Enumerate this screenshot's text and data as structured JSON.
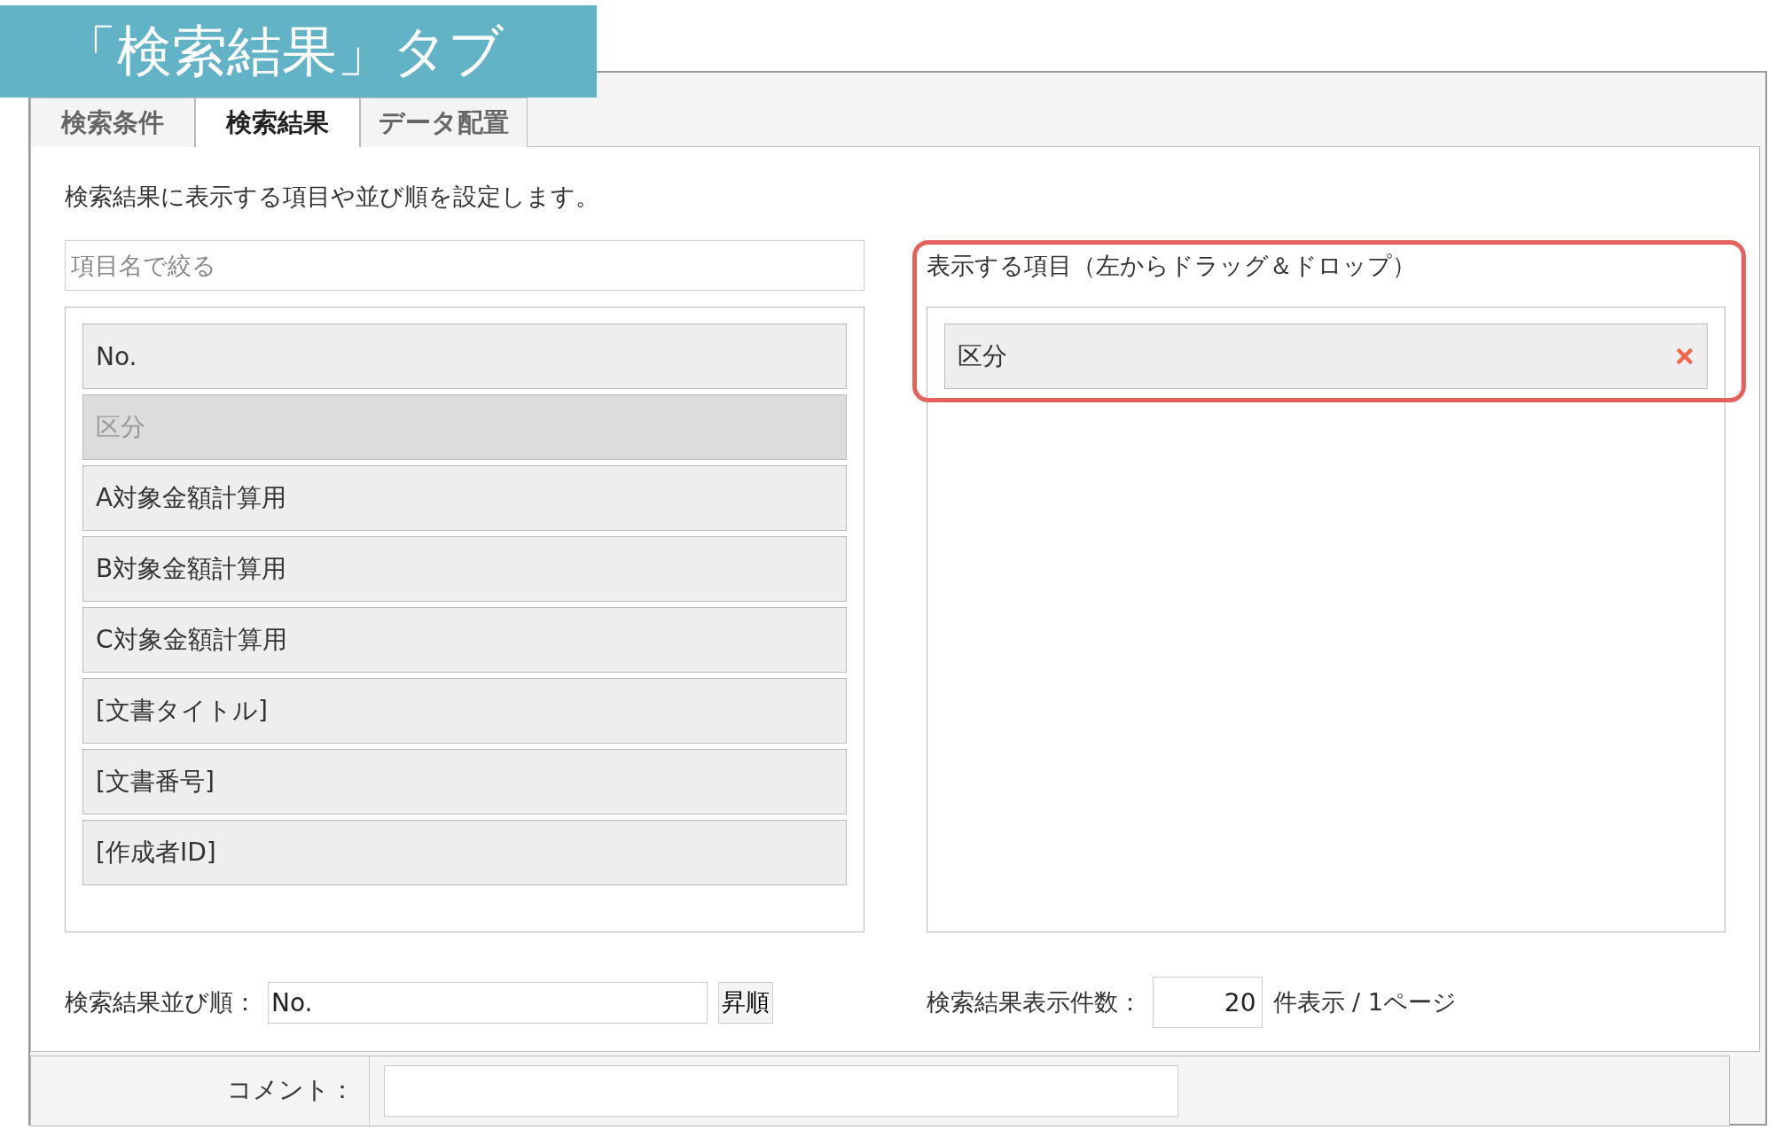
{
  "banner": {
    "title": "「検索結果」タブ"
  },
  "tabs": [
    {
      "label": "検索条件",
      "selected": false
    },
    {
      "label": "検索結果",
      "selected": true
    },
    {
      "label": "データ配置",
      "selected": false
    }
  ],
  "description": "検索結果に表示する項目や並び順を設定します。",
  "filter": {
    "placeholder": "項目名で絞る"
  },
  "available_items": [
    {
      "label": "No.",
      "disabled": false
    },
    {
      "label": "区分",
      "disabled": true
    },
    {
      "label": "A対象金額計算用",
      "disabled": false
    },
    {
      "label": "B対象金額計算用",
      "disabled": false
    },
    {
      "label": "C対象金額計算用",
      "disabled": false
    },
    {
      "label": "[文書タイトル]",
      "disabled": false
    },
    {
      "label": "[文書番号]",
      "disabled": false
    },
    {
      "label": "[作成者ID]",
      "disabled": false
    }
  ],
  "displayed": {
    "label": "表示する項目（左からドラッグ＆ドロップ）",
    "items": [
      {
        "label": "区分"
      }
    ]
  },
  "sort": {
    "label": "検索結果並び順：",
    "value": "No.",
    "button": "昇順"
  },
  "page_size": {
    "label": "検索結果表示件数：",
    "value": "20",
    "suffix": "件表示 / 1ページ"
  },
  "comment": {
    "label": "コメント："
  }
}
